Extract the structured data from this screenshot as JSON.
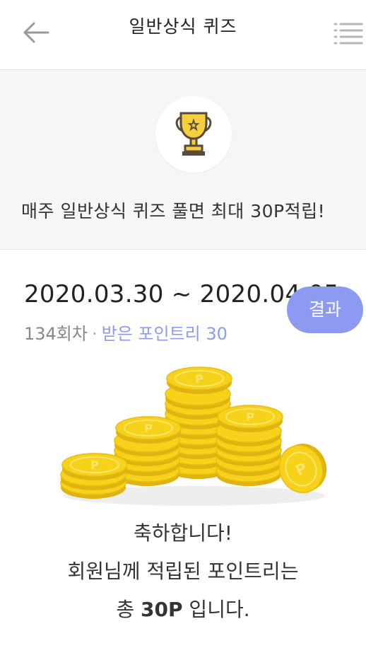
{
  "header": {
    "title": "일반상식 퀴즈",
    "back_icon": "arrow-left-icon",
    "menu_icon": "menu-list-icon"
  },
  "banner": {
    "icon": "trophy-icon",
    "text": "매주 일반상식 퀴즈 풀면 최대 30P적립!"
  },
  "quiz": {
    "date_range": "2020.03.30 ~ 2020.04.05",
    "round": "134회차",
    "separator": "·",
    "received_points": "받은 포인트리 30",
    "result_label": "결과"
  },
  "congrats": {
    "line1": "축하합니다!",
    "line2": "회원님께 적립된 포인트리는",
    "line3_prefix": "총 ",
    "line3_points": "30P",
    "line3_suffix": " 입니다."
  },
  "colors": {
    "accent": "#8d9af2",
    "coin": "#f7d21a",
    "banner_bg": "#f6f6f6"
  }
}
